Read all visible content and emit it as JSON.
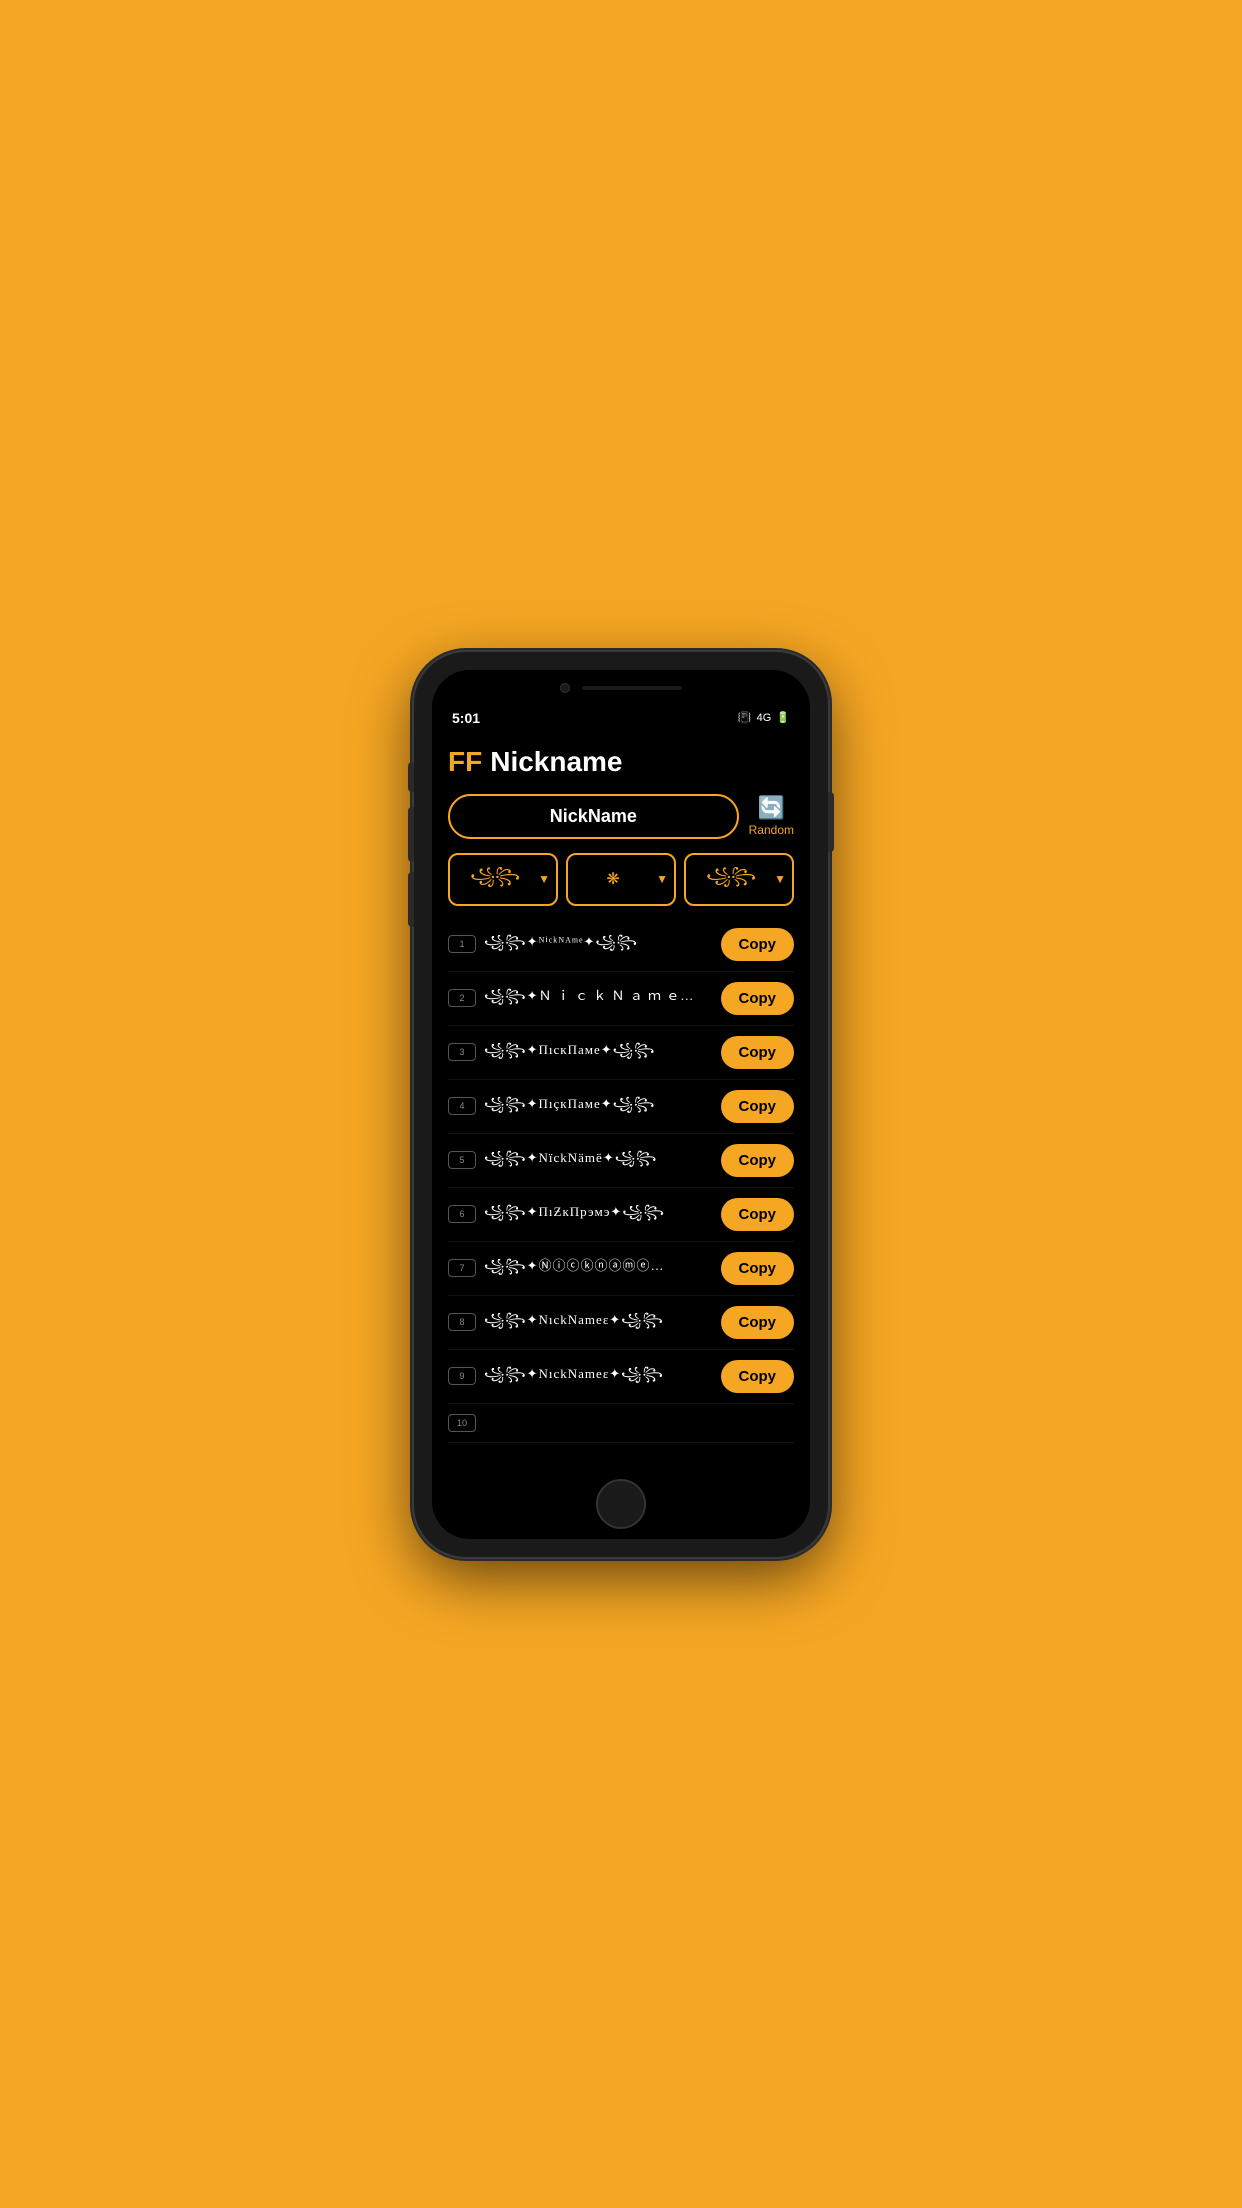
{
  "phone": {
    "status_bar": {
      "time": "5:01",
      "icons": "📳 4G 🔋"
    },
    "app": {
      "title_ff": "FF",
      "title_main": "Nickname",
      "input_placeholder": "NickName",
      "random_label": "Random",
      "filters": [
        {
          "symbol": "꧁꧂",
          "label": "filter1"
        },
        {
          "symbol": "❋",
          "label": "filter2"
        },
        {
          "symbol": "꧁꧂",
          "label": "filter3"
        }
      ],
      "nickname_rows": [
        {
          "num": "1",
          "text": "꧁꧂✦ᴺⁱᶜᵏᴺᴬᵐᵉ✦꧁꧂",
          "copy_label": "Copy"
        },
        {
          "num": "2",
          "text": "꧁꧂✦Ｎ ｉ ｃ ｋ Ｎ ａ ｍ ｅ…",
          "copy_label": "Copy"
        },
        {
          "num": "3",
          "text": "꧁꧂✦ПıcкПаме✦꧁꧂",
          "copy_label": "Copy"
        },
        {
          "num": "4",
          "text": "꧁꧂✦ПıçкПаме✦꧁꧂",
          "copy_label": "Copy"
        },
        {
          "num": "5",
          "text": "꧁꧂✦NïckNämë✦꧁꧂",
          "copy_label": "Copy"
        },
        {
          "num": "6",
          "text": "꧁꧂✦ΠıƵкΠрэмэ✦꧁꧂",
          "copy_label": "Copy"
        },
        {
          "num": "7",
          "text": "꧁꧂✦Ⓝⓘⓒⓚⓝⓐⓜⓔ…",
          "copy_label": "Copy"
        },
        {
          "num": "8",
          "text": "꧁꧂✦NıckNameε✦꧁꧂",
          "copy_label": "Copy"
        },
        {
          "num": "9",
          "text": "꧁꧂✦NıckNameε✦꧁꧂",
          "copy_label": "Copy"
        },
        {
          "num": "10",
          "text": "",
          "copy_label": ""
        }
      ]
    }
  }
}
